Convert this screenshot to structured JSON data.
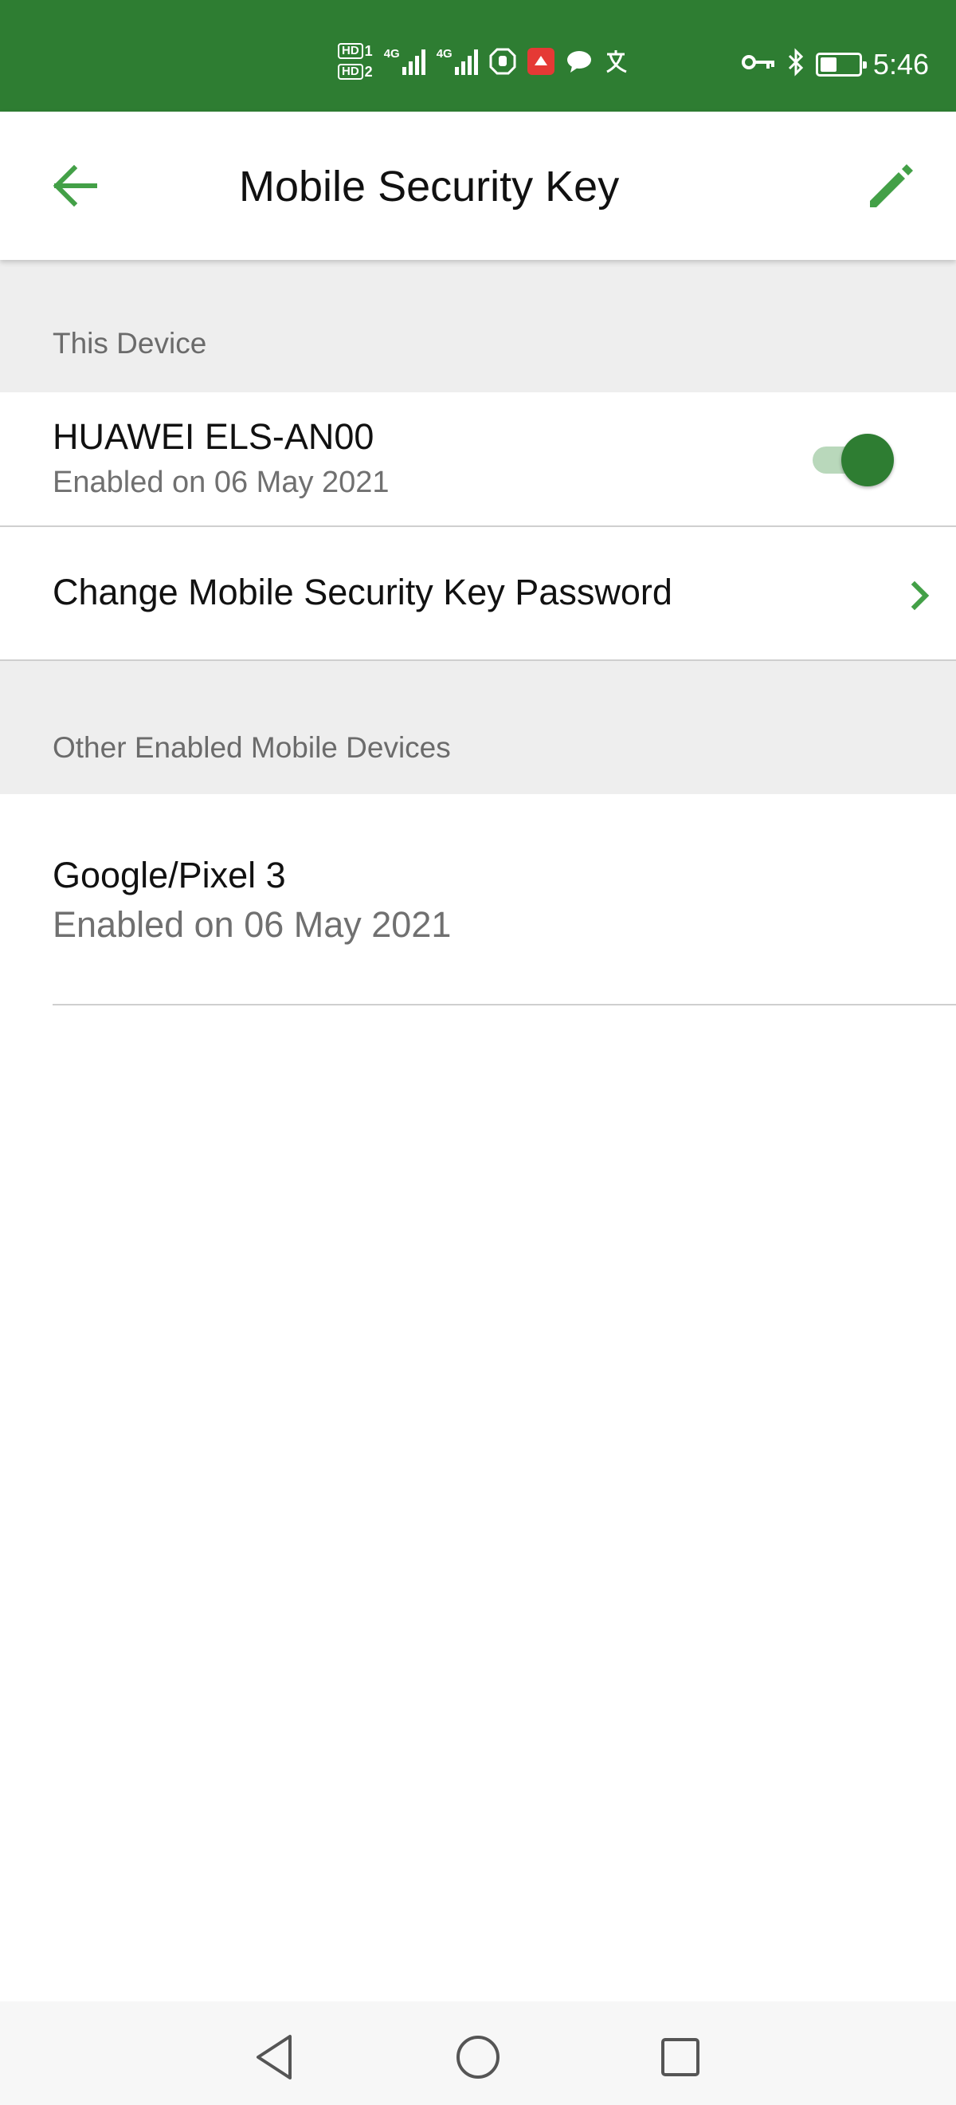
{
  "status_bar": {
    "time": "5:46",
    "sim1_label": "HD",
    "sim1_index": "1",
    "sim2_label": "HD",
    "sim2_index": "2",
    "network1": "4G",
    "network2": "4G",
    "icons": [
      "hd-sim1-icon",
      "hd-sim2-icon",
      "signal-4g-icon",
      "signal-4g-icon",
      "hand-icon",
      "app-notification-icon",
      "chat-icon",
      "translate-icon",
      "vpn-key-icon",
      "bluetooth-icon",
      "battery-icon"
    ]
  },
  "app_bar": {
    "title": "Mobile Security Key",
    "back_icon": "arrow-back-icon",
    "edit_icon": "pencil-icon"
  },
  "this_device": {
    "header": "This Device",
    "device_name": "HUAWEI ELS-AN00",
    "enabled_text": "Enabled on 06 May 2021",
    "toggle_on": true
  },
  "change_password": {
    "label": "Change Mobile Security Key Password",
    "icon": "chevron-right-icon"
  },
  "other_devices": {
    "header": "Other Enabled Mobile Devices",
    "items": [
      {
        "name": "Google/Pixel 3",
        "enabled_text": "Enabled on 06 May 2021"
      }
    ]
  },
  "nav_bar": {
    "icons": [
      "back-triangle-icon",
      "home-circle-icon",
      "recents-square-icon"
    ]
  },
  "colors": {
    "brand_green": "#2e7d32",
    "accent_green": "#43a047",
    "section_bg": "#eeeeee",
    "secondary_text": "#707070"
  }
}
